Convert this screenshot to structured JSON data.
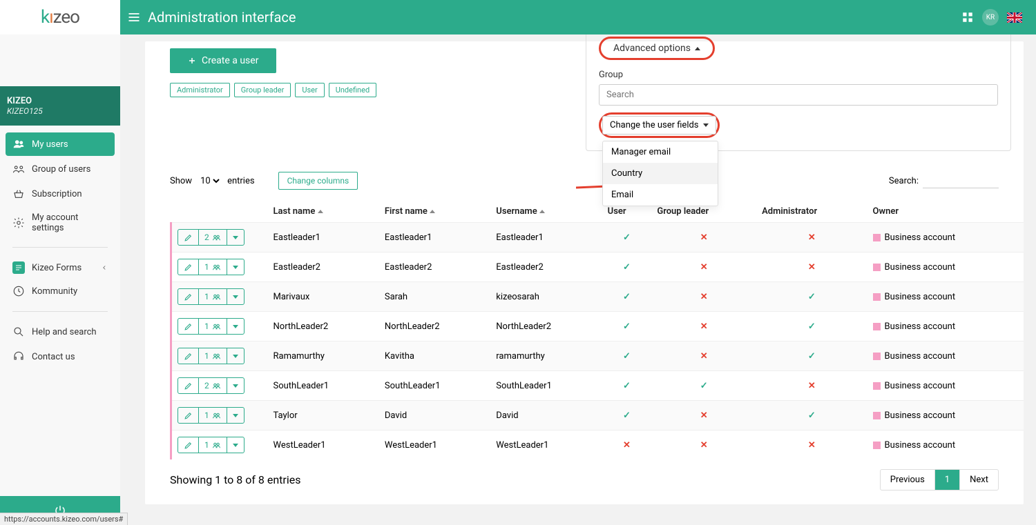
{
  "topbar": {
    "title": "Administration interface",
    "avatar": "KR"
  },
  "org": {
    "name": "KIZEO",
    "code": "KIZEO125"
  },
  "sidebar": {
    "items": [
      {
        "label": "My users",
        "active": true
      },
      {
        "label": "Group of users"
      },
      {
        "label": "Subscription"
      },
      {
        "label": "My account settings"
      }
    ],
    "secondary": [
      {
        "label": "Kizeo Forms"
      },
      {
        "label": "Kommunity"
      }
    ],
    "tertiary": [
      {
        "label": "Help and search"
      },
      {
        "label": "Contact us"
      }
    ]
  },
  "create_btn": "Create a user",
  "tags": [
    "Administrator",
    "Group leader",
    "User",
    "Undefined"
  ],
  "advanced": {
    "toggle": "Advanced options",
    "group_label": "Group",
    "search_placeholder": "Search",
    "change_btn": "Change the user fields",
    "dropdown": [
      "Manager email",
      "Country",
      "Email"
    ]
  },
  "table_ctrl": {
    "show": "Show",
    "entries": "entries",
    "count": "10",
    "change_cols": "Change columns",
    "search": "Search:"
  },
  "columns": [
    "Last name",
    "First name",
    "Username",
    "User",
    "Group leader",
    "Administrator",
    "Owner"
  ],
  "rows": [
    {
      "n": "2",
      "last": "Eastleader1",
      "first": "Eastleader1",
      "user": "Eastleader1",
      "u": true,
      "gl": false,
      "ad": false,
      "owner": "Business account"
    },
    {
      "n": "1",
      "last": "Eastleader2",
      "first": "Eastleader2",
      "user": "Eastleader2",
      "u": true,
      "gl": false,
      "ad": false,
      "owner": "Business account"
    },
    {
      "n": "1",
      "last": "Marivaux",
      "first": "Sarah",
      "user": "kizeosarah",
      "u": true,
      "gl": false,
      "ad": true,
      "owner": "Business account"
    },
    {
      "n": "1",
      "last": "NorthLeader2",
      "first": "NorthLeader2",
      "user": "NorthLeader2",
      "u": true,
      "gl": false,
      "ad": true,
      "owner": "Business account"
    },
    {
      "n": "1",
      "last": "Ramamurthy",
      "first": "Kavitha",
      "user": "ramamurthy",
      "u": true,
      "gl": false,
      "ad": true,
      "owner": "Business account"
    },
    {
      "n": "2",
      "last": "SouthLeader1",
      "first": "SouthLeader1",
      "user": "SouthLeader1",
      "u": true,
      "gl": true,
      "ad": false,
      "owner": "Business account"
    },
    {
      "n": "1",
      "last": "Taylor",
      "first": "David",
      "user": "David",
      "u": true,
      "gl": false,
      "ad": true,
      "owner": "Business account"
    },
    {
      "n": "1",
      "last": "WestLeader1",
      "first": "WestLeader1",
      "user": "WestLeader1",
      "u": false,
      "gl": false,
      "ad": false,
      "owner": "Business account"
    }
  ],
  "footer": {
    "info": "Showing 1 to 8 of 8 entries",
    "prev": "Previous",
    "page": "1",
    "next": "Next"
  },
  "url_tip": "https://accounts.kizeo.com/users#"
}
